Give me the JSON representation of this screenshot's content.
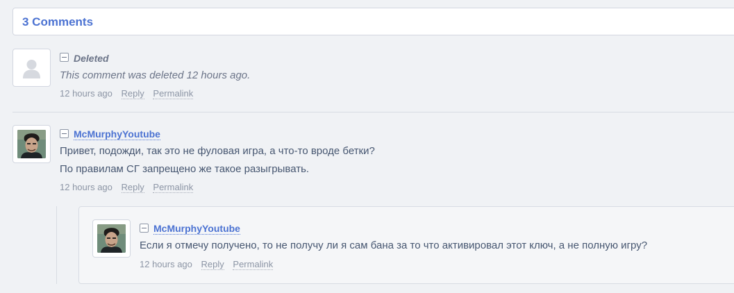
{
  "header": {
    "title": "3 Comments"
  },
  "comments": [
    {
      "author": "Deleted",
      "lines": [
        "This comment was deleted 12 hours ago."
      ],
      "time": "12 hours ago",
      "reply_label": "Reply",
      "permalink_label": "Permalink",
      "deleted": true
    },
    {
      "author": "McMurphyYoutube",
      "lines": [
        "Привет, подожди, так это не фуловая игра, а что-то вроде бетки?",
        "По правилам СГ запрещено же такое разыгрывать."
      ],
      "time": "12 hours ago",
      "reply_label": "Reply",
      "permalink_label": "Permalink",
      "deleted": false
    },
    {
      "author": "McMurphyYoutube",
      "lines": [
        "Если я отмечу получено, то не получу ли я сам бана за то что активировал этот ключ, а не полную игру?"
      ],
      "time": "12 hours ago",
      "reply_label": "Reply",
      "permalink_label": "Permalink",
      "deleted": false
    }
  ],
  "icons": {
    "collapse": "collapse-minus-icon",
    "avatar_placeholder": "user-silhouette-icon"
  },
  "colors": {
    "accent": "#4b72d2",
    "text": "#465670",
    "muted": "#8c95a5",
    "background": "#f0f2f5"
  }
}
